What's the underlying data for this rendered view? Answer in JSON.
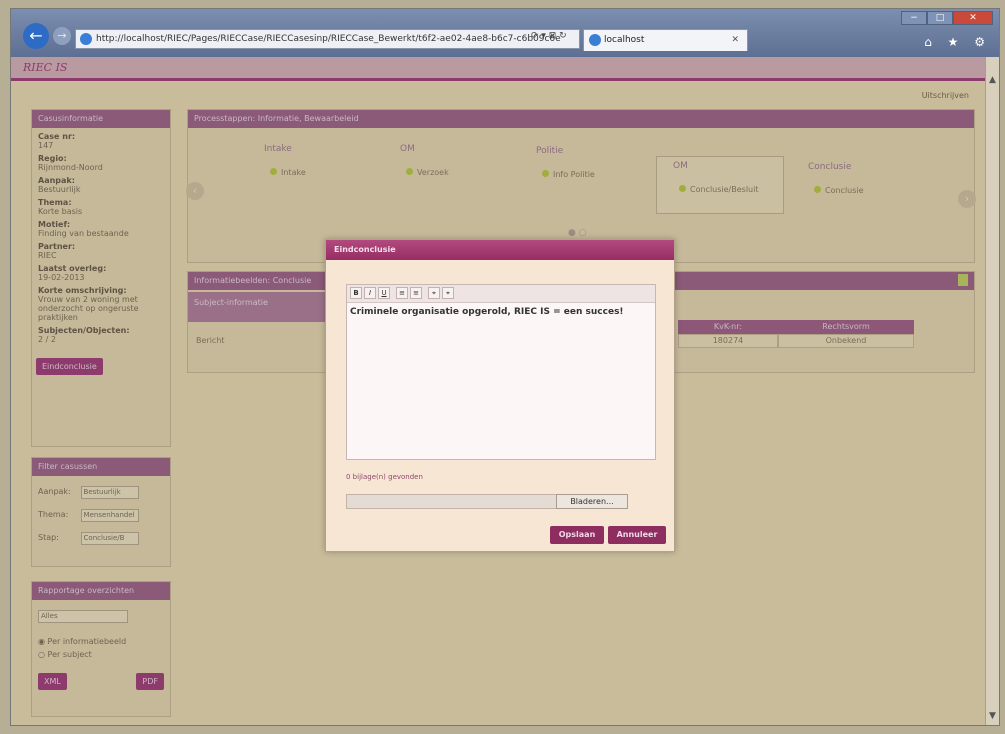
{
  "browser": {
    "url": "http://localhost/RIEC/Pages/RIECCase/RIECCasesinp/RIECCase_Bewerkt/t6f2-ae02-4ae8-b6c7-c6b09c6e",
    "tab_title": "localhost",
    "addr_controls": "⟳ ▾ ⊠ ↻",
    "win_min": "−",
    "win_max": "□",
    "win_close": "✕",
    "right_icons": "⌂ ★ ⚙"
  },
  "app": {
    "logo": "RIEC IS",
    "user_link": "Uitschrijven"
  },
  "sidebar": {
    "case_panel": {
      "title": "Casusinformatie",
      "fields": [
        {
          "label": "Case nr:",
          "value": "147"
        },
        {
          "label": "Regio:",
          "value": "Rijnmond-Noord"
        },
        {
          "label": "Aanpak:",
          "value": "Bestuurlijk"
        },
        {
          "label": "Thema:",
          "value": "Korte basis"
        },
        {
          "label": "Motief:",
          "value": "Finding van bestaande"
        },
        {
          "label": "Partner:",
          "value": "RIEC"
        },
        {
          "label": "Laatst overleg:",
          "value": "19-02-2013"
        },
        {
          "label": "Korte omschrijving:",
          "value": "Vrouw van 2 woning met onderzocht op ongeruste praktijken"
        },
        {
          "label": "Subjecten/Objecten:",
          "value": "2 / 2"
        }
      ],
      "button": "Eindconclusie"
    },
    "filter_panel": {
      "title": "Filter casussen",
      "rows": [
        {
          "label": "Aanpak:",
          "value": "Bestuurlijk"
        },
        {
          "label": "Thema:",
          "value": "Mensenhandel"
        },
        {
          "label": "Stap:",
          "value": "Conclusie/B"
        }
      ]
    },
    "report_panel": {
      "title": "Rapportage overzichten",
      "select": "Alles",
      "radio1": "Per informatiebeeld",
      "radio2": "Per subject",
      "btn_xml": "XML",
      "btn_pdf": "PDF"
    }
  },
  "timeline": {
    "title": "Processtappen: Informatie, Bewaarbeleid",
    "stages": [
      {
        "name": "Intake",
        "item": "Intake"
      },
      {
        "name": "OM",
        "item": "Verzoek"
      },
      {
        "name": "Politie",
        "item": "Info Politie"
      },
      {
        "name": "OM",
        "item": "Conclusie/Besluit"
      },
      {
        "name": "Conclusie",
        "item": "Conclusie"
      }
    ],
    "prev": "‹",
    "next": "›"
  },
  "info_panel": {
    "title": "Informatiebeelden: Conclusie",
    "row_label": "Subject-informatie",
    "row_value": "Bericht",
    "grid_headers": [
      "KvK-nr:",
      "Rechtsvorm"
    ],
    "grid_row": [
      "180274",
      "Onbekend"
    ]
  },
  "modal": {
    "title": "Eindconclusie",
    "toolbar": [
      "B",
      "I",
      "U",
      "≡",
      "≡",
      "⌖",
      "⌖"
    ],
    "text": "Criminele organisatie opgerold, RIEC IS = een succes!",
    "attach_label": "0 bijlage(n) gevonden",
    "browse": "Bladeren...",
    "save": "Opslaan",
    "cancel": "Annuleer"
  }
}
